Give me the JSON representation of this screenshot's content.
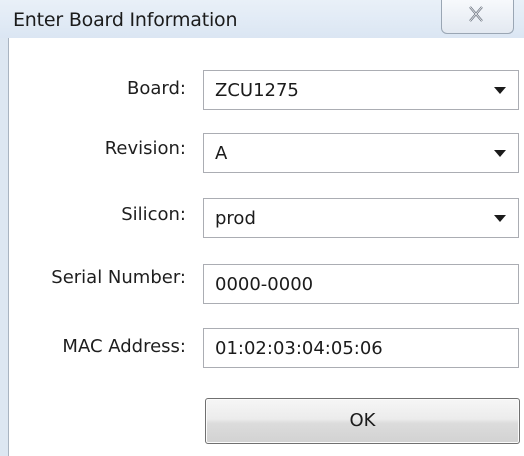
{
  "window": {
    "title": "Enter Board Information"
  },
  "form": {
    "board": {
      "label": "Board:",
      "value": "ZCU1275"
    },
    "revision": {
      "label": "Revision:",
      "value": "A"
    },
    "silicon": {
      "label": "Silicon:",
      "value": "prod"
    },
    "serial_number": {
      "label": "Serial Number:",
      "value": "0000-0000"
    },
    "mac_address": {
      "label": "MAC Address:",
      "value": "01:02:03:04:05:06"
    }
  },
  "buttons": {
    "ok_label": "OK"
  },
  "icons": {
    "close": "close-icon",
    "dropdown": "chevron-down-icon"
  }
}
